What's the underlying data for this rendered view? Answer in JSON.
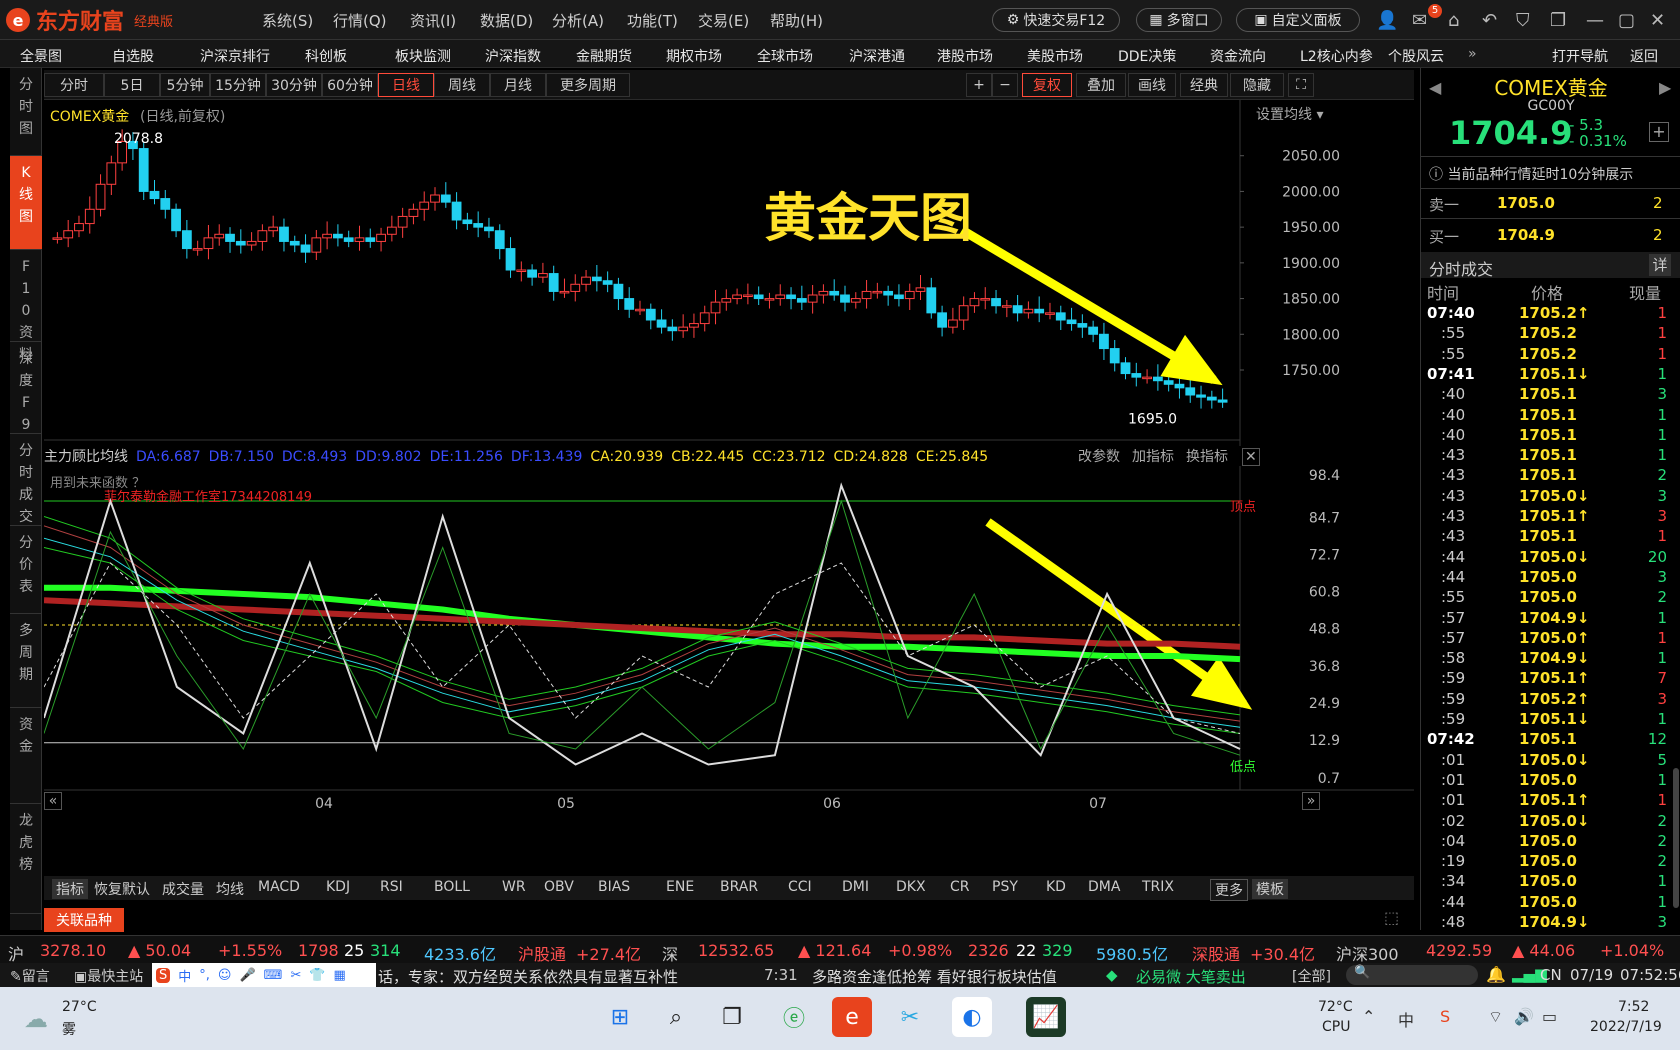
{
  "app": {
    "logo": "东方财富",
    "edition": "经典版"
  },
  "menu": [
    "系统(S)",
    "行情(Q)",
    "资讯(I)",
    "数据(D)",
    "分析(A)",
    "功能(T)",
    "交易(E)",
    "帮助(H)"
  ],
  "titlebtns": {
    "quick_trade": "快速交易F12",
    "multi_window": "多窗口",
    "custom_panel": "自定义面板",
    "mail_badge": "5"
  },
  "nav": [
    "全景图",
    "自选股",
    "沪深京排行",
    "科创板",
    "板块监测",
    "沪深指数",
    "金融期货",
    "期权市场",
    "全球市场",
    "沪深港通",
    "港股市场",
    "美股市场",
    "DDE决策",
    "资金流向",
    "L2核心内参",
    "个股风云"
  ],
  "nav_right": {
    "open_nav": "打开导航",
    "back": "返回"
  },
  "side_tabs": [
    "分时图",
    "K线图",
    "F10资料",
    "深度F9",
    "分时成交",
    "分价表",
    "多周期",
    "资金",
    "龙虎榜"
  ],
  "periods": [
    "分时",
    "5日",
    "5分钟",
    "15分钟",
    "30分钟",
    "60分钟",
    "日线",
    "周线",
    "月线",
    "更多周期"
  ],
  "active_period": "日线",
  "toolbtns": {
    "plus": "+",
    "minus": "−",
    "fuquan": "复权",
    "overlay": "叠加",
    "draw": "画线",
    "classic": "经典",
    "hide": "隐藏"
  },
  "chart": {
    "name": "COMEX黄金",
    "subtitle": "(日线,前复权)",
    "set_ma": "设置均线",
    "high_label": "2078.8",
    "low_label": "1695.0",
    "watermark": "黄金天图"
  },
  "chart_data": {
    "type": "candlestick",
    "title": "COMEX黄金",
    "price_axis": [
      "2050.00",
      "2000.00",
      "1950.00",
      "1900.00",
      "1850.00",
      "1800.00",
      "1750.00"
    ],
    "indicator_axis": [
      "98.4",
      "84.7",
      "72.7",
      "60.8",
      "48.8",
      "36.8",
      "24.9",
      "12.9",
      "0.7"
    ],
    "x_labels": [
      "04",
      "05",
      "06",
      "07"
    ],
    "high": 2078.8,
    "low": 1695.0,
    "ylim": [
      1680,
      2100
    ]
  },
  "indicator": {
    "label": "主力顾比均线",
    "items": [
      {
        "t": "DA:6.687",
        "c": "#3a4cff"
      },
      {
        "t": "DB:7.150",
        "c": "#3a4cff"
      },
      {
        "t": "DC:8.493",
        "c": "#3a4cff"
      },
      {
        "t": "DD:9.802",
        "c": "#3a4cff"
      },
      {
        "t": "DE:11.256",
        "c": "#3a4cff"
      },
      {
        "t": "DF:13.439",
        "c": "#3a4cff"
      },
      {
        "t": "CA:20.939",
        "c": "#ffe22a"
      },
      {
        "t": "CB:22.445",
        "c": "#ffe22a"
      },
      {
        "t": "CC:23.712",
        "c": "#ffe22a"
      },
      {
        "t": "CD:24.828",
        "c": "#ffe22a"
      },
      {
        "t": "CE:25.845",
        "c": "#ffe22a"
      }
    ],
    "change_param": "改参数",
    "add_ind": "加指标",
    "switch_ind": "换指标",
    "future_func": "用到未来函数",
    "future_q": "？",
    "studio": "菲尔泰勒金融工作室17344208149",
    "top_label": "顶点",
    "bottom_label": "低点"
  },
  "indicators_tabs": [
    "指标",
    "恢复默认",
    "成交量",
    "均线",
    "MACD",
    "KDJ",
    "RSI",
    "BOLL",
    "WR",
    "OBV",
    "BIAS",
    "ENE",
    "BRAR",
    "CCI",
    "DMI",
    "DKX",
    "CR",
    "PSY",
    "KD",
    "DMA",
    "TRIX",
    "更多",
    "模板"
  ],
  "related": "关联品种",
  "quote": {
    "name": "COMEX黄金",
    "code": "GC00Y",
    "price": "1704.9",
    "change": "- 5.3",
    "pct": "- 0.31%",
    "delay_note": "当前品种行情延时10分钟展示",
    "sell_label": "卖一",
    "sell_price": "1705.0",
    "sell_vol": "2",
    "buy_label": "买一",
    "buy_price": "1704.9",
    "buy_vol": "2",
    "ticks_title": "分时成交",
    "detail": "详",
    "cols": [
      "时间",
      "价格",
      "现量"
    ]
  },
  "ticks": [
    [
      "07:40",
      "1705.2↑",
      "1",
      "r"
    ],
    [
      ":55",
      "1705.2",
      "1",
      "r"
    ],
    [
      ":55",
      "1705.2",
      "1",
      "r"
    ],
    [
      "07:41",
      "1705.1↓",
      "1",
      "g"
    ],
    [
      ":40",
      "1705.1",
      "3",
      "g"
    ],
    [
      ":40",
      "1705.1",
      "1",
      "g"
    ],
    [
      ":40",
      "1705.1",
      "1",
      "g"
    ],
    [
      ":43",
      "1705.1",
      "1",
      "g"
    ],
    [
      ":43",
      "1705.1",
      "2",
      "g"
    ],
    [
      ":43",
      "1705.0↓",
      "3",
      "g"
    ],
    [
      ":43",
      "1705.1↑",
      "3",
      "r"
    ],
    [
      ":43",
      "1705.1",
      "1",
      "r"
    ],
    [
      ":44",
      "1705.0↓",
      "20",
      "g"
    ],
    [
      ":44",
      "1705.0",
      "3",
      "g"
    ],
    [
      ":55",
      "1705.0",
      "2",
      "g"
    ],
    [
      ":57",
      "1704.9↓",
      "1",
      "g"
    ],
    [
      ":57",
      "1705.0↑",
      "1",
      "r"
    ],
    [
      ":58",
      "1704.9↓",
      "1",
      "g"
    ],
    [
      ":59",
      "1705.1↑",
      "7",
      "r"
    ],
    [
      ":59",
      "1705.2↑",
      "3",
      "r"
    ],
    [
      ":59",
      "1705.1↓",
      "1",
      "g"
    ],
    [
      "07:42",
      "1705.1",
      "12",
      "g"
    ],
    [
      ":01",
      "1705.0↓",
      "5",
      "g"
    ],
    [
      ":01",
      "1705.0",
      "1",
      "g"
    ],
    [
      ":01",
      "1705.1↑",
      "1",
      "r"
    ],
    [
      ":02",
      "1705.0↓",
      "2",
      "g"
    ],
    [
      ":04",
      "1705.0",
      "2",
      "g"
    ],
    [
      ":19",
      "1705.0",
      "2",
      "g"
    ],
    [
      ":34",
      "1705.0",
      "1",
      "g"
    ],
    [
      ":44",
      "1705.0",
      "1",
      "g"
    ],
    [
      ":48",
      "1704.9↓",
      "3",
      "g"
    ]
  ],
  "footer": {
    "sh": "沪",
    "sh_idx": "3278.10",
    "sh_chg": "▲ 50.04",
    "sh_pct": "+1.55%",
    "sh_up": "1798",
    "sh_flat": "25",
    "sh_down": "314",
    "sh_amt": "4233.6亿",
    "hgt": "沪股通",
    "hgt_val": "+27.4亿",
    "sz": "深",
    "sz_idx": "12532.65",
    "sz_chg": "▲ 121.64",
    "sz_pct": "+0.98%",
    "sz_up": "2326",
    "sz_flat": "22",
    "sz_down": "329",
    "sz_amt": "5980.5亿",
    "sgt": "深股通",
    "sgt_val": "+30.4亿",
    "hs300": "沪深300",
    "hs300_idx": "4292.59",
    "hs300_chg": "▲ 44.06",
    "hs300_pct": "+1.04%"
  },
  "news": {
    "msg": "留言",
    "hub": "最快主站",
    "text1": "话，专家：双方经贸关系依然具有显著互补性",
    "time": "7:31",
    "text2": "多路资金逢低抢筹 看好银行板块估值",
    "bishang": "必易微 大笔卖出",
    "all": "[全部]",
    "cn": "CN",
    "date": "07/19",
    "clock": "07:52:56"
  },
  "taskbar": {
    "temp": "27°C",
    "weather": "雾",
    "cpu_temp": "72°C",
    "cpu": "CPU",
    "time": "7:52",
    "date": "2022/7/19"
  }
}
